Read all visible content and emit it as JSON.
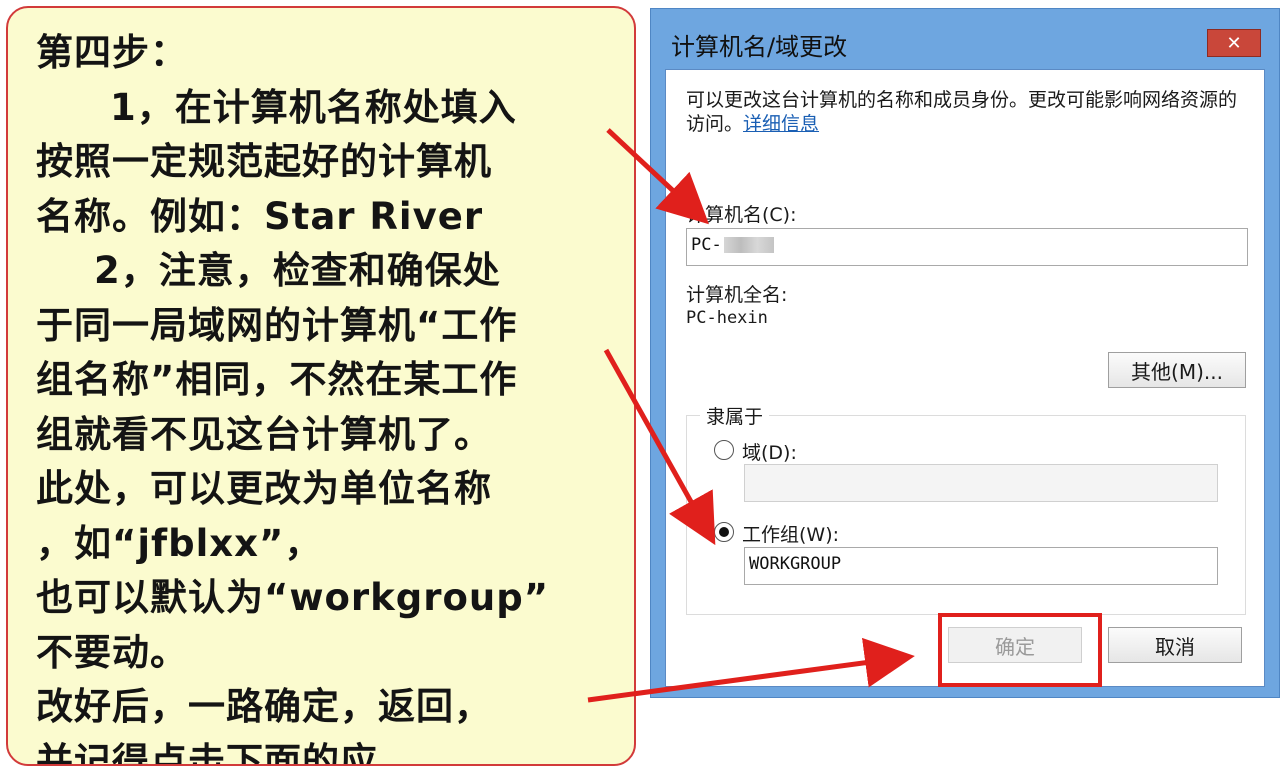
{
  "note": {
    "lines": [
      "第四步：",
      "1，在计算机名称处填入",
      "按照一定规范起好的计算机",
      "名称。例如：Star River",
      "2，注意，检查和确保处",
      "于同一局域网的计算机“工作",
      "组名称”相同，不然在某工作",
      "组就看不见这台计算机了。",
      "此处，可以更改为单位名称",
      "，如“jfblxx”，",
      "也可以默认为“workgroup”",
      "不要动。",
      "改好后，一路确定，返回，",
      "并记得点击下面的应..."
    ]
  },
  "dialog": {
    "title": "计算机名/域更改",
    "close_label": "✕",
    "desc_text": "可以更改这台计算机的名称和成员身份。更改可能影响网络资源的访问。",
    "desc_link": "详细信息",
    "computer_name_label": "计算机名(C):",
    "computer_name_value": "PC-",
    "full_name_label": "计算机全名:",
    "full_name_value": "PC-hexin",
    "other_button": "其他(M)...",
    "member_of_label": "隶属于",
    "domain_label": "域(D):",
    "domain_value": "",
    "workgroup_label": "工作组(W):",
    "workgroup_value": "WORKGROUP",
    "ok_button": "确定",
    "cancel_button": "取消"
  },
  "colors": {
    "annotation_red": "#e0201c",
    "note_background": "#fbfbcf",
    "dialog_frame": "#6ea6e0"
  }
}
